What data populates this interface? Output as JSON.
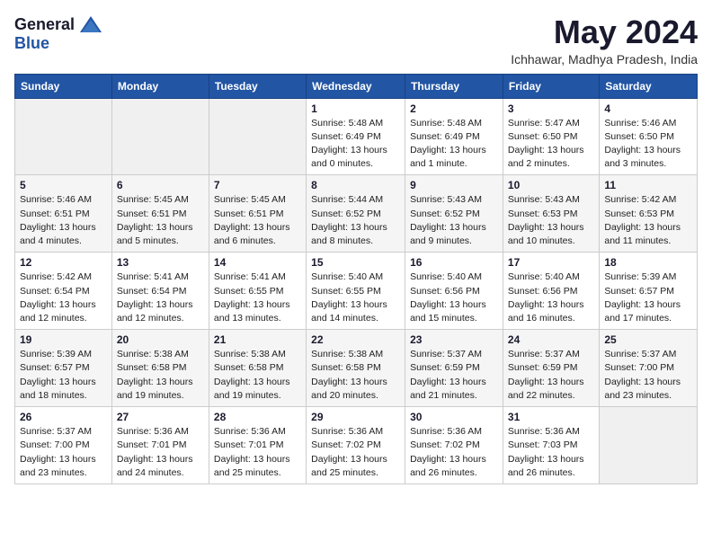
{
  "logo": {
    "general": "General",
    "blue": "Blue"
  },
  "title": {
    "month_year": "May 2024",
    "location": "Ichhawar, Madhya Pradesh, India"
  },
  "weekdays": [
    "Sunday",
    "Monday",
    "Tuesday",
    "Wednesday",
    "Thursday",
    "Friday",
    "Saturday"
  ],
  "weeks": [
    [
      {
        "day": "",
        "sunrise": "",
        "sunset": "",
        "daylight": ""
      },
      {
        "day": "",
        "sunrise": "",
        "sunset": "",
        "daylight": ""
      },
      {
        "day": "",
        "sunrise": "",
        "sunset": "",
        "daylight": ""
      },
      {
        "day": "1",
        "sunrise": "Sunrise: 5:48 AM",
        "sunset": "Sunset: 6:49 PM",
        "daylight": "Daylight: 13 hours and 0 minutes."
      },
      {
        "day": "2",
        "sunrise": "Sunrise: 5:48 AM",
        "sunset": "Sunset: 6:49 PM",
        "daylight": "Daylight: 13 hours and 1 minute."
      },
      {
        "day": "3",
        "sunrise": "Sunrise: 5:47 AM",
        "sunset": "Sunset: 6:50 PM",
        "daylight": "Daylight: 13 hours and 2 minutes."
      },
      {
        "day": "4",
        "sunrise": "Sunrise: 5:46 AM",
        "sunset": "Sunset: 6:50 PM",
        "daylight": "Daylight: 13 hours and 3 minutes."
      }
    ],
    [
      {
        "day": "5",
        "sunrise": "Sunrise: 5:46 AM",
        "sunset": "Sunset: 6:51 PM",
        "daylight": "Daylight: 13 hours and 4 minutes."
      },
      {
        "day": "6",
        "sunrise": "Sunrise: 5:45 AM",
        "sunset": "Sunset: 6:51 PM",
        "daylight": "Daylight: 13 hours and 5 minutes."
      },
      {
        "day": "7",
        "sunrise": "Sunrise: 5:45 AM",
        "sunset": "Sunset: 6:51 PM",
        "daylight": "Daylight: 13 hours and 6 minutes."
      },
      {
        "day": "8",
        "sunrise": "Sunrise: 5:44 AM",
        "sunset": "Sunset: 6:52 PM",
        "daylight": "Daylight: 13 hours and 8 minutes."
      },
      {
        "day": "9",
        "sunrise": "Sunrise: 5:43 AM",
        "sunset": "Sunset: 6:52 PM",
        "daylight": "Daylight: 13 hours and 9 minutes."
      },
      {
        "day": "10",
        "sunrise": "Sunrise: 5:43 AM",
        "sunset": "Sunset: 6:53 PM",
        "daylight": "Daylight: 13 hours and 10 minutes."
      },
      {
        "day": "11",
        "sunrise": "Sunrise: 5:42 AM",
        "sunset": "Sunset: 6:53 PM",
        "daylight": "Daylight: 13 hours and 11 minutes."
      }
    ],
    [
      {
        "day": "12",
        "sunrise": "Sunrise: 5:42 AM",
        "sunset": "Sunset: 6:54 PM",
        "daylight": "Daylight: 13 hours and 12 minutes."
      },
      {
        "day": "13",
        "sunrise": "Sunrise: 5:41 AM",
        "sunset": "Sunset: 6:54 PM",
        "daylight": "Daylight: 13 hours and 12 minutes."
      },
      {
        "day": "14",
        "sunrise": "Sunrise: 5:41 AM",
        "sunset": "Sunset: 6:55 PM",
        "daylight": "Daylight: 13 hours and 13 minutes."
      },
      {
        "day": "15",
        "sunrise": "Sunrise: 5:40 AM",
        "sunset": "Sunset: 6:55 PM",
        "daylight": "Daylight: 13 hours and 14 minutes."
      },
      {
        "day": "16",
        "sunrise": "Sunrise: 5:40 AM",
        "sunset": "Sunset: 6:56 PM",
        "daylight": "Daylight: 13 hours and 15 minutes."
      },
      {
        "day": "17",
        "sunrise": "Sunrise: 5:40 AM",
        "sunset": "Sunset: 6:56 PM",
        "daylight": "Daylight: 13 hours and 16 minutes."
      },
      {
        "day": "18",
        "sunrise": "Sunrise: 5:39 AM",
        "sunset": "Sunset: 6:57 PM",
        "daylight": "Daylight: 13 hours and 17 minutes."
      }
    ],
    [
      {
        "day": "19",
        "sunrise": "Sunrise: 5:39 AM",
        "sunset": "Sunset: 6:57 PM",
        "daylight": "Daylight: 13 hours and 18 minutes."
      },
      {
        "day": "20",
        "sunrise": "Sunrise: 5:38 AM",
        "sunset": "Sunset: 6:58 PM",
        "daylight": "Daylight: 13 hours and 19 minutes."
      },
      {
        "day": "21",
        "sunrise": "Sunrise: 5:38 AM",
        "sunset": "Sunset: 6:58 PM",
        "daylight": "Daylight: 13 hours and 19 minutes."
      },
      {
        "day": "22",
        "sunrise": "Sunrise: 5:38 AM",
        "sunset": "Sunset: 6:58 PM",
        "daylight": "Daylight: 13 hours and 20 minutes."
      },
      {
        "day": "23",
        "sunrise": "Sunrise: 5:37 AM",
        "sunset": "Sunset: 6:59 PM",
        "daylight": "Daylight: 13 hours and 21 minutes."
      },
      {
        "day": "24",
        "sunrise": "Sunrise: 5:37 AM",
        "sunset": "Sunset: 6:59 PM",
        "daylight": "Daylight: 13 hours and 22 minutes."
      },
      {
        "day": "25",
        "sunrise": "Sunrise: 5:37 AM",
        "sunset": "Sunset: 7:00 PM",
        "daylight": "Daylight: 13 hours and 23 minutes."
      }
    ],
    [
      {
        "day": "26",
        "sunrise": "Sunrise: 5:37 AM",
        "sunset": "Sunset: 7:00 PM",
        "daylight": "Daylight: 13 hours and 23 minutes."
      },
      {
        "day": "27",
        "sunrise": "Sunrise: 5:36 AM",
        "sunset": "Sunset: 7:01 PM",
        "daylight": "Daylight: 13 hours and 24 minutes."
      },
      {
        "day": "28",
        "sunrise": "Sunrise: 5:36 AM",
        "sunset": "Sunset: 7:01 PM",
        "daylight": "Daylight: 13 hours and 25 minutes."
      },
      {
        "day": "29",
        "sunrise": "Sunrise: 5:36 AM",
        "sunset": "Sunset: 7:02 PM",
        "daylight": "Daylight: 13 hours and 25 minutes."
      },
      {
        "day": "30",
        "sunrise": "Sunrise: 5:36 AM",
        "sunset": "Sunset: 7:02 PM",
        "daylight": "Daylight: 13 hours and 26 minutes."
      },
      {
        "day": "31",
        "sunrise": "Sunrise: 5:36 AM",
        "sunset": "Sunset: 7:03 PM",
        "daylight": "Daylight: 13 hours and 26 minutes."
      },
      {
        "day": "",
        "sunrise": "",
        "sunset": "",
        "daylight": ""
      }
    ]
  ]
}
